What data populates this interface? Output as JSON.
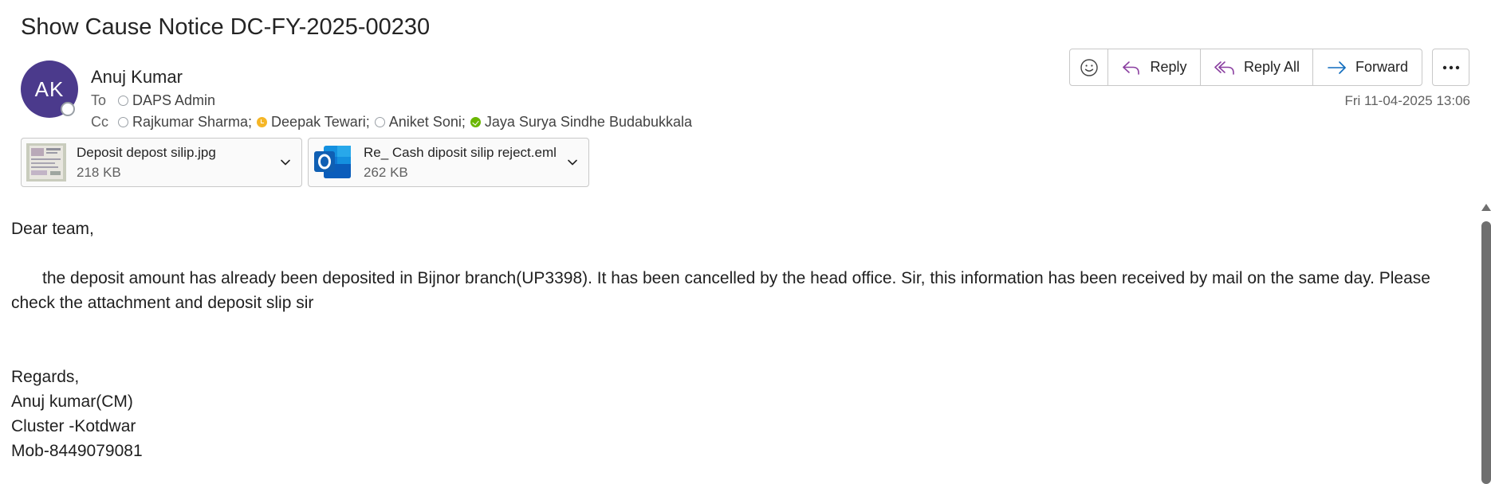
{
  "email": {
    "subject": "Show Cause Notice DC-FY-2025-00230",
    "sender": {
      "initials": "AK",
      "name": "Anuj Kumar",
      "avatar_color": "#4b3a8c"
    },
    "to_label": "To",
    "cc_label": "Cc",
    "to": [
      {
        "name": "DAPS Admin",
        "status": "offline"
      }
    ],
    "cc": [
      {
        "name": "Rajkumar Sharma;",
        "status": "offline"
      },
      {
        "name": "Deepak Tewari;",
        "status": "away"
      },
      {
        "name": "Aniket Soni;",
        "status": "offline"
      },
      {
        "name": "Jaya Surya Sindhe Budabukkala",
        "status": "available"
      }
    ],
    "date": "Fri 11-04-2025 13:06"
  },
  "actions": {
    "emoji_icon": "smiley-icon",
    "reply": "Reply",
    "reply_all": "Reply All",
    "forward": "Forward",
    "more_icon": "more-horizontal-icon"
  },
  "attachments": [
    {
      "name": "Deposit depost silip.jpg",
      "size": "218 KB",
      "type": "image"
    },
    {
      "name": "Re_ Cash diposit silip reject.eml",
      "size": "262 KB",
      "type": "outlook-email"
    }
  ],
  "body": {
    "greeting": "Dear team,",
    "paragraph": "the deposit amount has already been deposited in Bijnor branch(UP3398). It has been cancelled by the head office. Sir, this information has been received by mail on the same day. Please check the attachment and deposit slip sir",
    "signature": [
      "Regards,",
      "Anuj kumar(CM)",
      "Cluster -Kotdwar",
      "Mob-8449079081"
    ]
  },
  "colors": {
    "accent_purple": "#8a3fa0",
    "forward_blue": "#0f6cbd",
    "presence_away": "#f5b627",
    "presence_available": "#6bb700"
  }
}
